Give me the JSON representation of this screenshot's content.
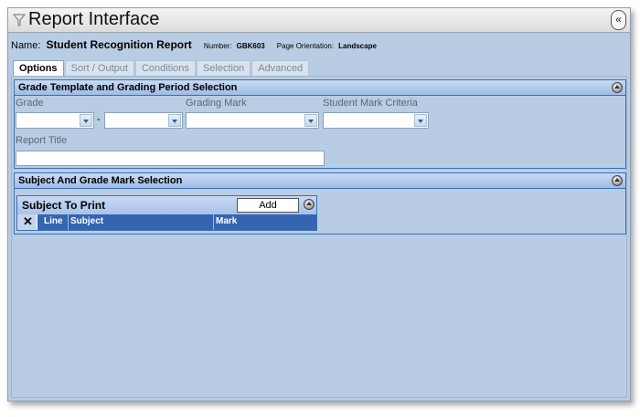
{
  "window": {
    "title": "Report Interface",
    "collapse_label": "«"
  },
  "report": {
    "name_label": "Name:",
    "name": "Student Recognition Report",
    "number_label": "Number:",
    "number": "GBK603",
    "orientation_label": "Page Orientation:",
    "orientation": "Landscape"
  },
  "tabs": [
    "Options",
    "Sort / Output",
    "Conditions",
    "Selection",
    "Advanced"
  ],
  "grade_section": {
    "title": "Grade Template and Grading Period Selection",
    "grade_label": "Grade",
    "grade_from": "",
    "grade_separator": "-",
    "grade_to": "",
    "grading_mark_label": "Grading Mark",
    "grading_mark": "",
    "criteria_label": "Student Mark Criteria",
    "criteria": "",
    "report_title_label": "Report Title",
    "report_title": ""
  },
  "subject_section": {
    "title": "Subject And Grade Mark Selection",
    "table_title": "Subject To Print",
    "add_label": "Add",
    "columns": {
      "delete": "✕",
      "line": "Line",
      "subject": "Subject",
      "mark": "Mark"
    }
  },
  "colors": {
    "background": "#b8cde4",
    "header_blue": "#3565b0",
    "section_border": "#3a6fb7"
  }
}
